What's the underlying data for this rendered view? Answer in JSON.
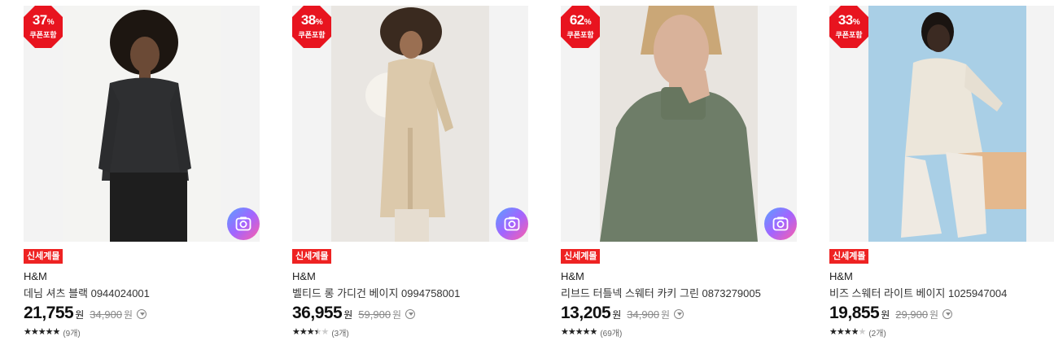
{
  "products": [
    {
      "discount_value": "37",
      "discount_unit": "%",
      "discount_sub": "쿠폰포함",
      "tag": "신세계몰",
      "brand": "H&M",
      "name": "데님 셔츠 블랙 0944024001",
      "price": "21,755",
      "price_unit": "원",
      "original_price": "34,900",
      "original_unit": "원",
      "rating": 5,
      "reviews": "(9개)",
      "stars_text": "★★★★★",
      "photo_colors": {
        "bg": "#f4f4f2",
        "garment": "#2e2f31",
        "skin": "#6b4a36",
        "hair": "#1d1611",
        "pants": "#1e1e1e"
      }
    },
    {
      "discount_value": "38",
      "discount_unit": "%",
      "discount_sub": "쿠폰포함",
      "tag": "신세계몰",
      "brand": "H&M",
      "name": "벨티드 롱 가디건 베이지 0994758001",
      "price": "36,955",
      "price_unit": "원",
      "original_price": "59,900",
      "original_unit": "원",
      "rating": 3.5,
      "reviews": "(3개)",
      "stars_text": "★★★★★",
      "photo_colors": {
        "bg": "#e9e6e2",
        "garment": "#dcc9ab",
        "skin": "#9a6f52",
        "hair": "#3a2a1f",
        "pants": "#e6ddd0"
      }
    },
    {
      "discount_value": "62",
      "discount_unit": "%",
      "discount_sub": "쿠폰포함",
      "tag": "신세계몰",
      "brand": "H&M",
      "name": "리브드 터틀넥 스웨터 카키 그린 0873279005",
      "price": "13,205",
      "price_unit": "원",
      "original_price": "34,900",
      "original_unit": "원",
      "rating": 5,
      "reviews": "(69개)",
      "stars_text": "★★★★★",
      "photo_colors": {
        "bg": "#e8e4df",
        "garment": "#6e7d68",
        "skin": "#d9b29a",
        "hair": "#caa777",
        "pants": "#6e7d68"
      }
    },
    {
      "discount_value": "33",
      "discount_unit": "%",
      "discount_sub": "쿠폰포함",
      "tag": "신세계몰",
      "brand": "H&M",
      "name": "비즈 스웨터 라이트 베이지 1025947004",
      "price": "19,855",
      "price_unit": "원",
      "original_price": "29,900",
      "original_unit": "원",
      "rating": 4,
      "reviews": "(2개)",
      "stars_text": "★★★★★",
      "photo_colors": {
        "bg": "#a9cfe6",
        "garment": "#ece6da",
        "skin": "#3b2a22",
        "hair": "#1a1411",
        "pants": "#efeae2"
      }
    }
  ],
  "colors": {
    "discount_badge": "#e8141f",
    "tag": "#e22222",
    "lens_gradient": [
      "#5aa0ff",
      "#a264ff",
      "#ff5fa8"
    ]
  },
  "icons": {
    "camera_lens": "camera-search-icon",
    "info": "info-dropdown-icon",
    "star": "star-icon"
  }
}
